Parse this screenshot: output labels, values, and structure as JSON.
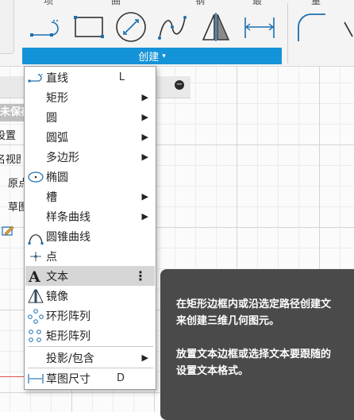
{
  "toolbar": {
    "top_labels": [
      "项",
      "曲",
      "钢",
      "最",
      "量"
    ],
    "create_label": "创建",
    "create_caret": "▾",
    "tools": [
      "line-icon",
      "rectangle-icon",
      "circle-icon",
      "spline-icon",
      "mirror-icon",
      "dimension-icon",
      "fillet-icon"
    ]
  },
  "browser": {
    "rows": [
      "未保存",
      "设置",
      "名视图",
      "原点",
      "草图"
    ],
    "minus": "−"
  },
  "menu": {
    "items": [
      {
        "icon": "line-icon",
        "label": "直线",
        "shortcut": "L",
        "submenu": false
      },
      {
        "icon": "",
        "label": "矩形",
        "shortcut": "",
        "submenu": true
      },
      {
        "icon": "",
        "label": "圆",
        "shortcut": "",
        "submenu": true
      },
      {
        "icon": "",
        "label": "圆弧",
        "shortcut": "",
        "submenu": true
      },
      {
        "icon": "",
        "label": "多边形",
        "shortcut": "",
        "submenu": true
      },
      {
        "icon": "ellipse-icon",
        "label": "椭圆",
        "shortcut": "",
        "submenu": false
      },
      {
        "icon": "",
        "label": "槽",
        "shortcut": "",
        "submenu": true
      },
      {
        "icon": "",
        "label": "样条曲线",
        "shortcut": "",
        "submenu": true
      },
      {
        "icon": "conic-curve-icon",
        "label": "圆锥曲线",
        "shortcut": "",
        "submenu": false
      },
      {
        "icon": "point-icon",
        "label": "点",
        "shortcut": "",
        "submenu": false
      },
      {
        "icon": "text-icon",
        "label": "文本",
        "shortcut": "",
        "submenu": false,
        "highlighted": true
      },
      {
        "icon": "mirror-icon",
        "label": "镜像",
        "shortcut": "",
        "submenu": false
      },
      {
        "icon": "circular-pattern-icon",
        "label": "环形阵列",
        "shortcut": "",
        "submenu": false
      },
      {
        "icon": "rectangular-pattern-icon",
        "label": "矩形阵列",
        "shortcut": "",
        "submenu": false
      },
      {
        "icon": "",
        "label": "投影/包含",
        "shortcut": "",
        "submenu": true
      },
      {
        "icon": "sketch-dimension-icon",
        "label": "草图尺寸",
        "shortcut": "D",
        "submenu": false
      }
    ],
    "arrow": "▶",
    "more_dots": "⋮"
  },
  "tooltip": {
    "line1": "在矩形边框内或沿选定路径创建文",
    "line2": "来创建三维几何图元。",
    "line3": "放置文本边框或选择文本要跟随的",
    "line4": "设置文本格式。"
  },
  "colors": {
    "accent": "#1493d8",
    "icon_blue": "#1a6fb0",
    "tooltip_bg": "#4a4a4a"
  }
}
